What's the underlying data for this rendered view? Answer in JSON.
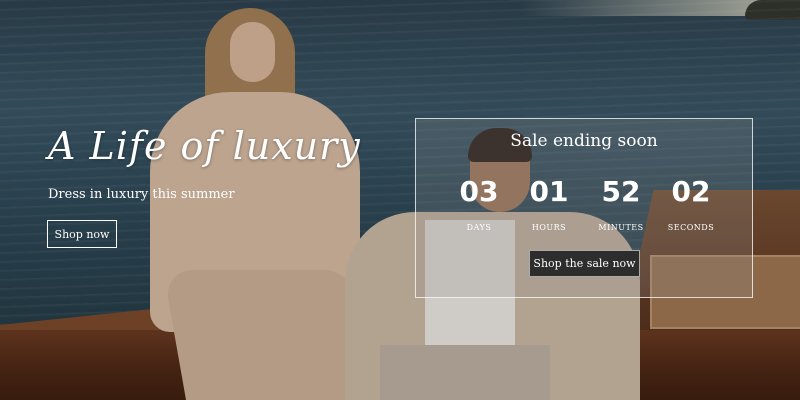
{
  "hero": {
    "title": "A Life of luxury",
    "subtitle": "Dress in luxury this summer",
    "cta_label": "Shop now"
  },
  "sale": {
    "title": "Sale ending soon",
    "countdown": [
      {
        "value": "03",
        "label": "DAYS"
      },
      {
        "value": "01",
        "label": "HOURS"
      },
      {
        "value": "52",
        "label": "MINUTES"
      },
      {
        "value": "02",
        "label": "SECONDS"
      }
    ],
    "cta_label": "Shop the sale now"
  },
  "colors": {
    "text": "#ffffff",
    "button_dark": "#2d2d2d",
    "sea": "#3a5666",
    "wood": "#6b3b22"
  }
}
